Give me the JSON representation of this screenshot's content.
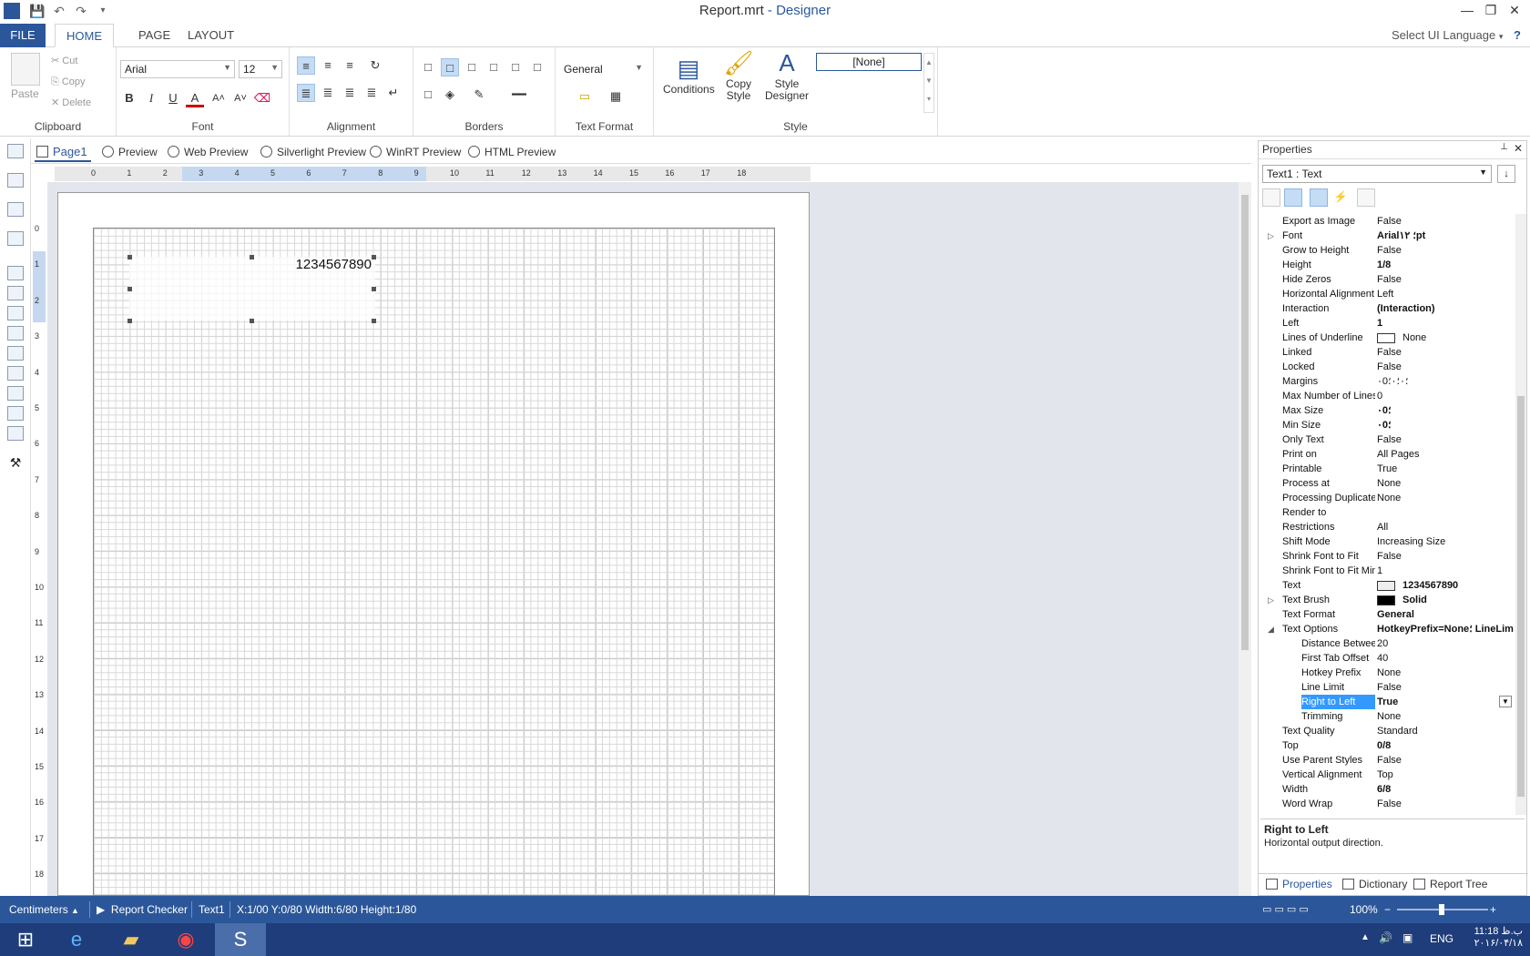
{
  "window": {
    "file_name": "Report.mrt",
    "app_suffix": " - Designer",
    "min_glyph": "—",
    "max_glyph": "❐",
    "close_glyph": "✕"
  },
  "ribbon_tabs": [
    "FILE",
    "HOME",
    "PAGE",
    "LAYOUT"
  ],
  "ui_language": "Select UI Language",
  "help_glyph": "?",
  "clipboard": {
    "paste": "Paste",
    "cut": "Cut",
    "copy": "Copy",
    "delete": "Delete",
    "label": "Clipboard"
  },
  "font_group": {
    "family": "Arial",
    "size": "12",
    "label": "Font",
    "bold": "B",
    "italic": "I",
    "underline": "U",
    "color": "A"
  },
  "alignment_label": "Alignment",
  "borders_label": "Borders",
  "text_format": {
    "value": "General",
    "label": "Text Format"
  },
  "style_group": {
    "conditions": "Conditions",
    "copy_style_1": "Copy",
    "copy_style_2": "Style",
    "designer_1": "Style",
    "designer_2": "Designer",
    "none_style": "[None]",
    "label": "Style"
  },
  "page_tabs": {
    "page1": "Page1",
    "preview": "Preview",
    "web_preview": "Web Preview",
    "silverlight_preview": "Silverlight Preview",
    "winrt_preview": "WinRT Preview",
    "html_preview": "HTML Preview"
  },
  "ruler_h": [
    "0",
    "1",
    "2",
    "3",
    "4",
    "5",
    "6",
    "7",
    "8",
    "9",
    "10",
    "11",
    "12",
    "13",
    "14",
    "15",
    "16",
    "17",
    "18"
  ],
  "ruler_v": [
    "0",
    "1",
    "2",
    "3",
    "4",
    "5",
    "6",
    "7",
    "8",
    "9",
    "10",
    "11",
    "12",
    "13",
    "14",
    "15",
    "16",
    "17",
    "18"
  ],
  "text_component": {
    "content": "1234567890"
  },
  "properties": {
    "title": "Properties",
    "pin_glyph": "📌",
    "close_glyph": "✕",
    "selected_object": "Text1 : Text",
    "rows": [
      {
        "name": "Export as Image",
        "value": "False"
      },
      {
        "name": "Font",
        "value": "Arial؛ ۱۲pt",
        "expand": "▷",
        "bold": true
      },
      {
        "name": "Grow to Height",
        "value": "False"
      },
      {
        "name": "Height",
        "value": "1/8",
        "bold": true
      },
      {
        "name": "Hide Zeros",
        "value": "False"
      },
      {
        "name": "Horizontal Alignment",
        "value": "Left"
      },
      {
        "name": "Interaction",
        "value": "(Interaction)",
        "bold": true
      },
      {
        "name": "Left",
        "value": "1",
        "bold": true
      },
      {
        "name": "Lines of Underline",
        "value": "None",
        "swatch": "#ffffff"
      },
      {
        "name": "Linked",
        "value": "False"
      },
      {
        "name": "Locked",
        "value": "False"
      },
      {
        "name": "Margins",
        "value": "۰؛۰؛۰؛0"
      },
      {
        "name": "Max Number of Lines",
        "value": "0"
      },
      {
        "name": "Max Size",
        "value": "۰؛0",
        "bold": true
      },
      {
        "name": "Min Size",
        "value": "۰؛0",
        "bold": true
      },
      {
        "name": "Only Text",
        "value": "False"
      },
      {
        "name": "Print on",
        "value": "All Pages"
      },
      {
        "name": "Printable",
        "value": "True"
      },
      {
        "name": "Process at",
        "value": "None"
      },
      {
        "name": "Processing Duplicates",
        "value": "None"
      },
      {
        "name": "Render to",
        "value": ""
      },
      {
        "name": "Restrictions",
        "value": "All"
      },
      {
        "name": "Shift Mode",
        "value": "Increasing Size"
      },
      {
        "name": "Shrink Font to Fit",
        "value": "False"
      },
      {
        "name": "Shrink Font to Fit Minimum",
        "value": "1"
      },
      {
        "name": "Text",
        "value": "1234567890",
        "bold": true,
        "swatch": "#eeeeee"
      },
      {
        "name": "Text Brush",
        "value": "Solid",
        "expand": "▷",
        "bold": true,
        "swatch": "#000000"
      },
      {
        "name": "Text Format",
        "value": "General",
        "bold": true
      },
      {
        "name": "Text Options",
        "value": "HotkeyPrefix=None؛ LineLimit",
        "expand": "◢",
        "bold": true
      },
      {
        "name": "Distance Between Tabs",
        "value": "20",
        "indent": true
      },
      {
        "name": "First Tab Offset",
        "value": "40",
        "indent": true
      },
      {
        "name": "Hotkey Prefix",
        "value": "None",
        "indent": true
      },
      {
        "name": "Line Limit",
        "value": "False",
        "indent": true
      },
      {
        "name": "Right to Left",
        "value": "True",
        "indent": true,
        "bold": true,
        "selected": true
      },
      {
        "name": "Trimming",
        "value": "None",
        "indent": true
      },
      {
        "name": "Text Quality",
        "value": "Standard"
      },
      {
        "name": "Top",
        "value": "0/8",
        "bold": true
      },
      {
        "name": "Use Parent Styles",
        "value": "False"
      },
      {
        "name": "Vertical Alignment",
        "value": "Top"
      },
      {
        "name": "Width",
        "value": "6/8",
        "bold": true
      },
      {
        "name": "Word Wrap",
        "value": "False"
      }
    ],
    "description_title": "Right to Left",
    "description_text": "Horizontal output direction.",
    "bottom_tabs": {
      "properties": "Properties",
      "dictionary": "Dictionary",
      "report_tree": "Report Tree"
    }
  },
  "status": {
    "units": "Centimeters",
    "report_checker": "Report Checker",
    "component": "Text1",
    "position": "X:1/00  Y:0/80  Width:6/80  Height:1/80",
    "zoom": "100%"
  },
  "taskbar": {
    "language": "ENG",
    "time": "11:18 ب.ظ",
    "date": "۲۰۱۶/۰۴/۱۸"
  }
}
